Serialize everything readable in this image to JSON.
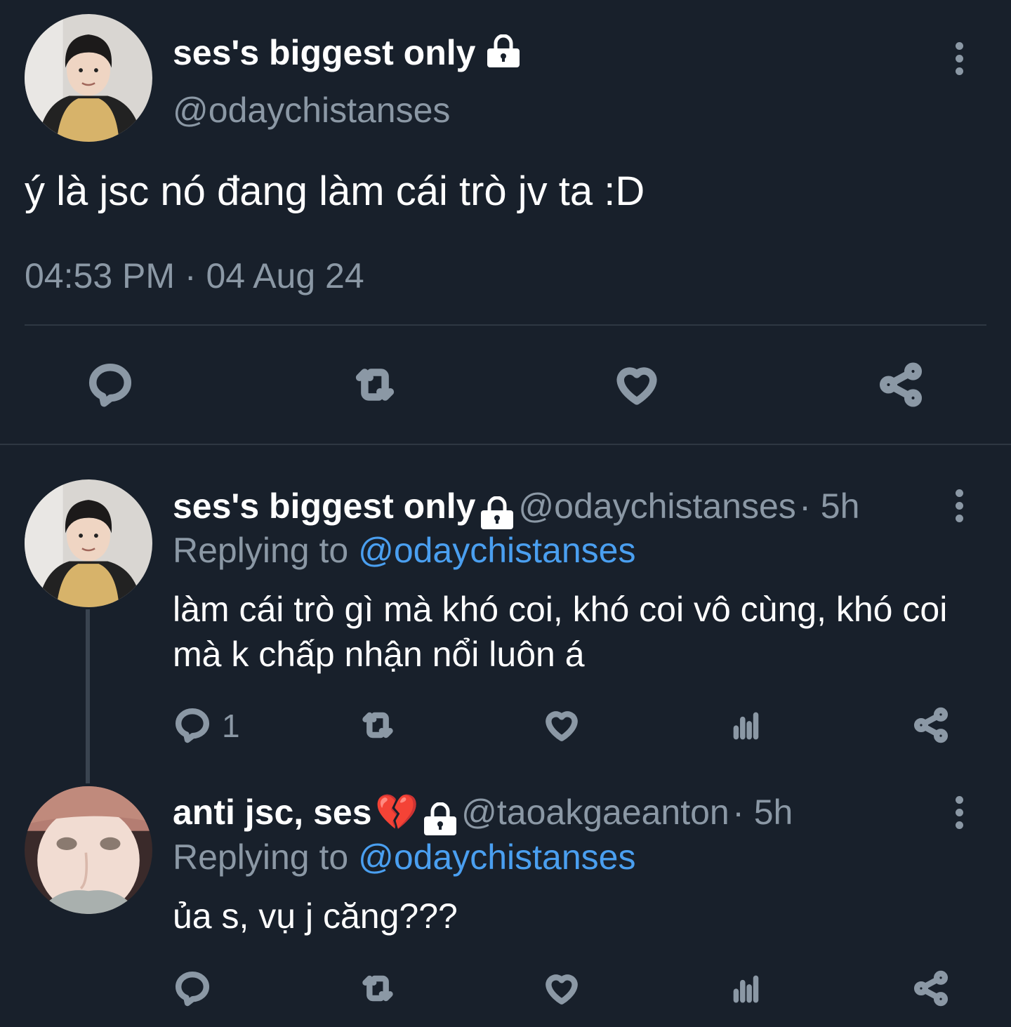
{
  "main_tweet": {
    "display_name": "ses's biggest only",
    "handle": "@odaychistanses",
    "text": "ý là jsc nó đang làm cái trò jv ta :D",
    "timestamp": "04:53 PM · 04 Aug 24",
    "actions": [
      "reply-icon",
      "retweet-icon",
      "like-icon",
      "share-icon"
    ]
  },
  "replies": [
    {
      "display_name": "ses's biggest only",
      "handle": "@odaychistanses",
      "age": "· 5h",
      "replying_prefix": "Replying to",
      "replying_to": "@odaychistanses",
      "text": "làm cái trò gì mà khó coi, khó coi vô cùng, khó coi mà k chấp nhận nổi luôn á",
      "reply_count": "1",
      "actions": [
        "reply-icon",
        "retweet-icon",
        "like-icon",
        "views-icon",
        "share-icon"
      ]
    },
    {
      "display_name": "anti jsc, ses",
      "emoji": "💔",
      "handle": "@taoakgaeanton",
      "age": "· 5h",
      "replying_prefix": "Replying to",
      "replying_to": "@odaychistanses",
      "text": "ủa s, vụ j căng???",
      "reply_count": "",
      "actions": [
        "reply-icon",
        "retweet-icon",
        "like-icon",
        "views-icon",
        "share-icon"
      ]
    }
  ],
  "colors": {
    "background": "#18202b",
    "text": "#ffffff",
    "muted": "#8b98a5",
    "link": "#4a9ff0",
    "divider": "#2e3742"
  }
}
